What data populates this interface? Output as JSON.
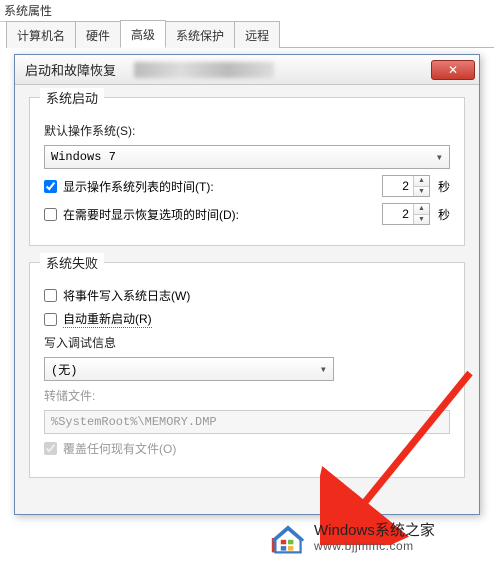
{
  "parent_title_fragment": "系统属性",
  "tabs": {
    "computer_name": "计算机名",
    "hardware": "硬件",
    "advanced": "高级",
    "system_protection": "系统保护",
    "remote": "远程"
  },
  "dialog": {
    "title": "启动和故障恢复"
  },
  "startup": {
    "group_title": "系统启动",
    "default_os_label": "默认操作系统(S):",
    "default_os_value": "Windows 7",
    "show_os_list_label": "显示操作系统列表的时间(T):",
    "show_os_list_checked": true,
    "show_os_list_seconds": "2",
    "show_recovery_label": "在需要时显示恢复选项的时间(D):",
    "show_recovery_checked": false,
    "show_recovery_seconds": "2",
    "seconds_unit": "秒"
  },
  "failure": {
    "group_title": "系统失败",
    "write_event_label": "将事件写入系统日志(W)",
    "write_event_checked": false,
    "auto_restart_label": "自动重新启动(R)",
    "auto_restart_checked": false,
    "debug_info_label": "写入调试信息",
    "debug_select_value": "(无)",
    "dump_file_label": "转储文件:",
    "dump_file_value": "%SystemRoot%\\MEMORY.DMP",
    "overwrite_label": "覆盖任何现有文件(O)",
    "overwrite_checked": true
  },
  "watermark": {
    "line1": "Windows系统之家",
    "line2": "www.bjjmmc.com"
  }
}
